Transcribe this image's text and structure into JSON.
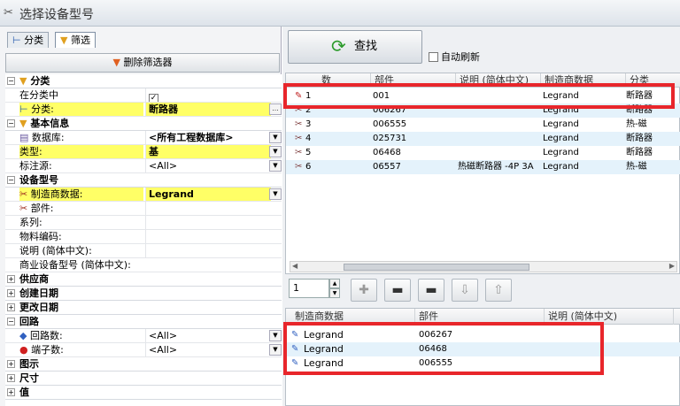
{
  "window": {
    "title": "选择设备型号"
  },
  "tabs": [
    {
      "label": "分类",
      "icon": "tree-icon"
    },
    {
      "label": "筛选",
      "icon": "funnel-icon"
    }
  ],
  "filter": {
    "delete_label": "删除筛选器"
  },
  "props": {
    "cat_classify": "分类",
    "in_class": "在分类中",
    "in_class_checked": "✓",
    "classify": "分类:",
    "classify_val": "断路器",
    "cat_basic": "基本信息",
    "database": "数据库:",
    "database_val": "<所有工程数据库>",
    "type": "类型:",
    "type_val": "基",
    "mark_src": "标注源:",
    "mark_src_val": "<All>",
    "cat_model": "设备型号",
    "mfr": "制造商数据:",
    "mfr_val": "Legrand",
    "part": "部件:",
    "series": "系列:",
    "material": "物料编码:",
    "desc": "说明 (简体中文):",
    "commercial": "商业设备型号 (简体中文):",
    "cat_supplier": "供应商",
    "cat_created": "创建日期",
    "cat_modified": "更改日期",
    "cat_circuit": "回路",
    "circuits": "回路数:",
    "circuits_val": "<All>",
    "terminals": "端子数:",
    "terminals_val": "<All>",
    "cat_symbol": "图示",
    "cat_size": "尺寸",
    "cat_value": "值"
  },
  "search": {
    "find_label": "查找",
    "auto_refresh_label": "自动刷新"
  },
  "results": {
    "columns": [
      "数",
      "部件",
      "说明 (简体中文)",
      "制造商数据",
      "分类"
    ],
    "rows": [
      {
        "num": "1",
        "part": "001",
        "desc": "",
        "mfr": "Legrand",
        "cls": "断路器"
      },
      {
        "num": "2",
        "part": "006267",
        "desc": "",
        "mfr": "Legrand",
        "cls": "断路器"
      },
      {
        "num": "3",
        "part": "006555",
        "desc": "",
        "mfr": "Legrand",
        "cls": "热-磁"
      },
      {
        "num": "4",
        "part": "025731",
        "desc": "",
        "mfr": "Legrand",
        "cls": "断路器"
      },
      {
        "num": "5",
        "part": "06468",
        "desc": "",
        "mfr": "Legrand",
        "cls": "断路器"
      },
      {
        "num": "6",
        "part": "06557",
        "desc": "热磁断路器 -4P 3A",
        "mfr": "Legrand",
        "cls": "热-磁"
      }
    ]
  },
  "pager": {
    "page": "1"
  },
  "bottom": {
    "columns": [
      "制造商数据",
      "部件",
      "说明 (简体中文)"
    ],
    "rows": [
      {
        "mfr": "Legrand",
        "part": "006267"
      },
      {
        "mfr": "Legrand",
        "part": "06468"
      },
      {
        "mfr": "Legrand",
        "part": "006555"
      }
    ]
  },
  "colors": {
    "highlight": "#ffff66",
    "annotation_box": "#e8262b",
    "selection": "#e4f2fb"
  }
}
